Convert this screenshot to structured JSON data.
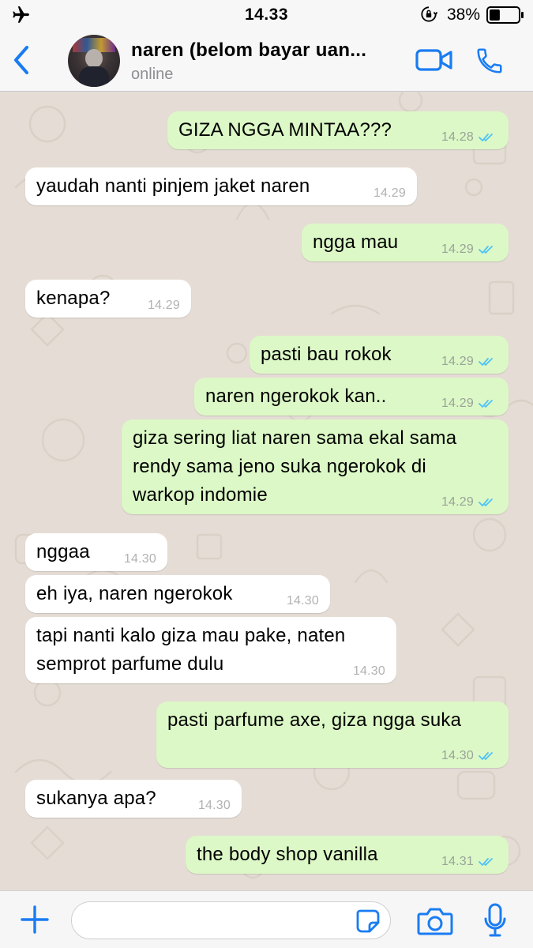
{
  "status_bar": {
    "time": "14.33",
    "battery_percent": "38%",
    "battery_level": 0.38,
    "icons": [
      "airplane-icon",
      "orientation-lock-icon",
      "battery-icon"
    ]
  },
  "header": {
    "contact_name": "naren (belom bayar uan...",
    "presence": "online",
    "icons": [
      "back-chevron-icon",
      "video-call-icon",
      "phone-call-icon"
    ]
  },
  "messages": [
    {
      "direction": "out",
      "text": "GIZA NGGA MINTAA???",
      "time": "14.28",
      "read": true
    },
    {
      "direction": "in",
      "text": "yaudah nanti pinjem jaket naren",
      "time": "14.29"
    },
    {
      "direction": "out",
      "text": "ngga mau",
      "time": "14.29",
      "read": true
    },
    {
      "direction": "in",
      "text": "kenapa?",
      "time": "14.29"
    },
    {
      "direction": "out",
      "text": "pasti bau rokok",
      "time": "14.29",
      "read": true
    },
    {
      "direction": "out",
      "text": "naren ngerokok kan..",
      "time": "14.29",
      "read": true
    },
    {
      "direction": "out",
      "text": "giza sering liat naren sama ekal sama\nrendy sama jeno suka ngerokok di\nwarkop indomie",
      "time": "14.29",
      "read": true
    },
    {
      "direction": "in",
      "text": "nggaa",
      "time": "14.30"
    },
    {
      "direction": "in",
      "text": "eh iya, naren ngerokok",
      "time": "14.30"
    },
    {
      "direction": "in",
      "text": "tapi nanti kalo giza mau pake, naten\nsemprot parfume dulu",
      "time": "14.30"
    },
    {
      "direction": "out",
      "text": "pasti parfume axe, giza ngga suka",
      "time": "14.30",
      "read": true
    },
    {
      "direction": "in",
      "text": "sukanya apa?",
      "time": "14.30"
    },
    {
      "direction": "out",
      "text": "the body shop vanilla",
      "time": "14.31",
      "read": true
    }
  ],
  "input": {
    "placeholder": "",
    "value": "",
    "icons": [
      "plus-icon",
      "sticker-icon",
      "camera-icon",
      "microphone-icon"
    ]
  },
  "colors": {
    "accent": "#1a7cf2",
    "outgoing_bubble": "#dcf8c6",
    "incoming_bubble": "#ffffff",
    "chat_background": "#e5ddd5",
    "read_ticks": "#4fc3f7"
  }
}
